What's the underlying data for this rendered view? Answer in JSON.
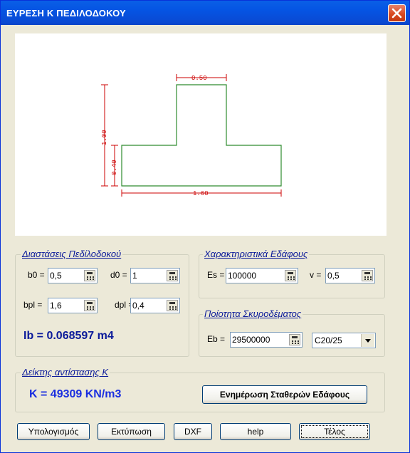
{
  "window": {
    "title": "ΕΥΡΕΣΗ Κ ΠΕΔΙΛΟΔΟΚΟΥ"
  },
  "drawing": {
    "dim_top": "0.50",
    "dim_height": "1.00",
    "dim_flange": "0.40",
    "dim_bottom": "1.60"
  },
  "dimensions_group": {
    "title": "Διαστάσεις Πεδίλοδοκού",
    "b0_label": "b0 =",
    "b0_value": "0,5",
    "d0_label": "d0 =",
    "d0_value": "1",
    "bpl_label": "bpl =",
    "bpl_value": "1,6",
    "dpl_label": "dpl =",
    "dpl_value": "0,4",
    "ib_text": "Ib = 0.068597 m4"
  },
  "soil_group": {
    "title": "Χαρακτηριστικά Εδάφους",
    "es_label": "Es =",
    "es_value": "100000",
    "v_label": "v =",
    "v_value": "0,5"
  },
  "concrete_group": {
    "title": "Ποίοτητα Σκυροδέματος",
    "eb_label": "Eb =",
    "eb_value": "29500000",
    "class_selected": "C20/25"
  },
  "k_group": {
    "title": "Δείκτης αντίστασης Κ",
    "k_text": "K = 49309 KN/m3",
    "update_button": "Ενημέρωση Σταθερών Εδάφους"
  },
  "buttons": {
    "calculate": "Υπολογισμός",
    "print": "Εκτύπωση",
    "dxf": "DXF",
    "help": "help",
    "end": "Τέλος"
  },
  "colors": {
    "title_bar": "#0a5fe6",
    "shape_outline": "#2e8b2e",
    "dimension_lines": "#cc0000",
    "group_titles": "#0b1a9a"
  }
}
